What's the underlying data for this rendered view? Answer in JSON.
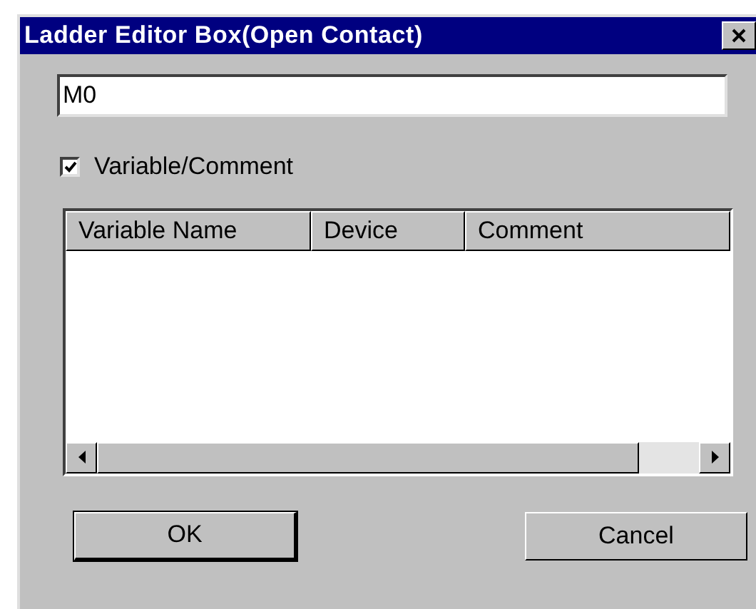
{
  "window": {
    "title": "Ladder Editor Box(Open Contact)"
  },
  "device_field": {
    "value": "M0"
  },
  "variable_comment": {
    "label": "Variable/Comment",
    "checked": true
  },
  "table": {
    "columns": [
      "Variable Name",
      "Device",
      "Comment"
    ]
  },
  "buttons": [
    {
      "label": "OK",
      "default": true
    },
    {
      "label": "Cancel",
      "default": false
    }
  ]
}
